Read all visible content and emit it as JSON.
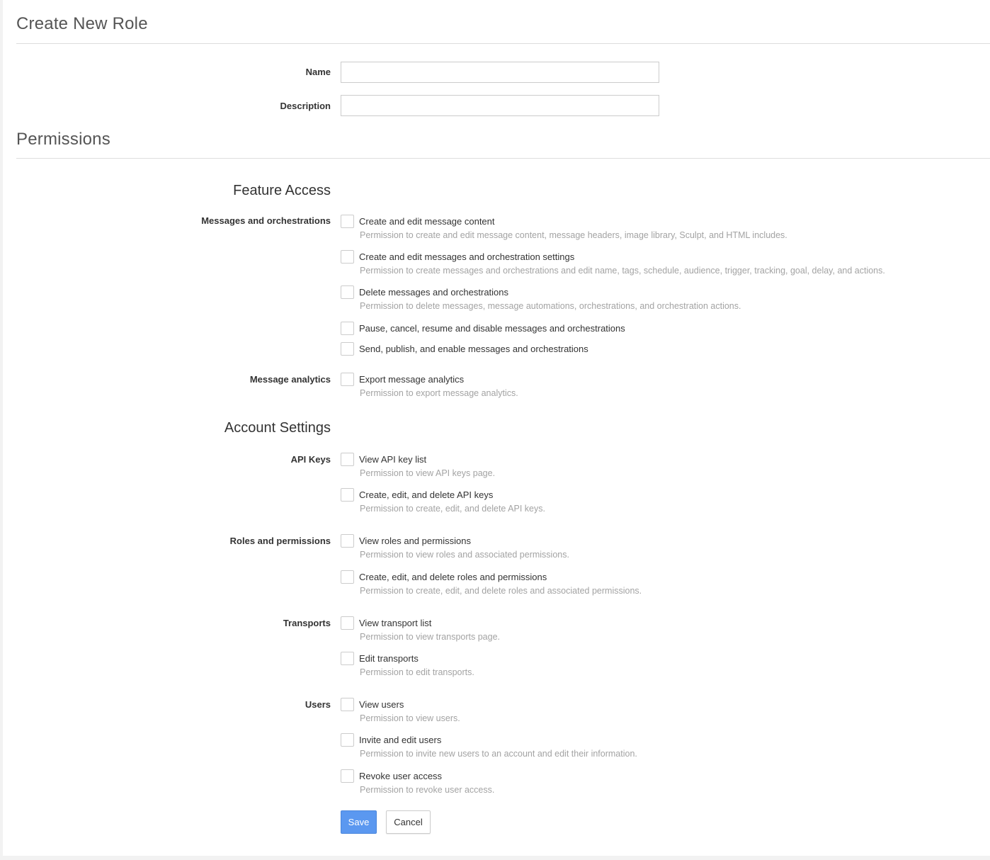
{
  "page": {
    "title": "Create New Role"
  },
  "form": {
    "name_label": "Name",
    "name_value": "",
    "description_label": "Description",
    "description_value": ""
  },
  "permissions": {
    "title": "Permissions",
    "feature_access": {
      "heading": "Feature Access",
      "messages_label": "Messages and orchestrations",
      "messages_items": [
        {
          "title": "Create and edit message content",
          "desc": "Permission to create and edit message content, message headers, image library, Sculpt, and HTML includes.",
          "checked": false
        },
        {
          "title": "Create and edit messages and orchestration settings",
          "desc": "Permission to create messages and orchestrations and edit name, tags, schedule, audience, trigger, tracking, goal, delay, and actions.",
          "checked": false
        },
        {
          "title": "Delete messages and orchestrations",
          "desc": "Permission to delete messages, message automations, orchestrations, and orchestration actions.",
          "checked": false
        },
        {
          "title": "Pause, cancel, resume and disable messages and orchestrations",
          "checked": false
        },
        {
          "title": "Send, publish, and enable messages and orchestrations",
          "checked": false
        }
      ],
      "analytics_label": "Message analytics",
      "analytics_items": [
        {
          "title": "Export message analytics",
          "desc": "Permission to export message analytics.",
          "checked": false
        }
      ]
    },
    "account_settings": {
      "heading": "Account Settings",
      "api_label": "API Keys",
      "api_items": [
        {
          "title": "View API key list",
          "desc": "Permission to view API keys page.",
          "checked": false
        },
        {
          "title": "Create, edit, and delete API keys",
          "desc": "Permission to create, edit, and delete API keys.",
          "checked": false
        }
      ],
      "roles_label": "Roles and permissions",
      "roles_items": [
        {
          "title": "View roles and permissions",
          "desc": "Permission to view roles and associated permissions.",
          "checked": false
        },
        {
          "title": "Create, edit, and delete roles and permissions",
          "desc": "Permission to create, edit, and delete roles and associated permissions.",
          "checked": false
        }
      ],
      "transports_label": "Transports",
      "transports_items": [
        {
          "title": "View transport list",
          "desc": "Permission to view transports page.",
          "checked": false
        },
        {
          "title": "Edit transports",
          "desc": "Permission to edit transports.",
          "checked": false
        }
      ],
      "users_label": "Users",
      "users_items": [
        {
          "title": "View users",
          "desc": "Permission to view users.",
          "checked": false
        },
        {
          "title": "Invite and edit users",
          "desc": "Permission to invite new users to an account and edit their information.",
          "checked": false
        },
        {
          "title": "Revoke user access",
          "desc": "Permission to revoke user access.",
          "checked": false
        }
      ]
    }
  },
  "actions": {
    "save_label": "Save",
    "cancel_label": "Cancel"
  }
}
